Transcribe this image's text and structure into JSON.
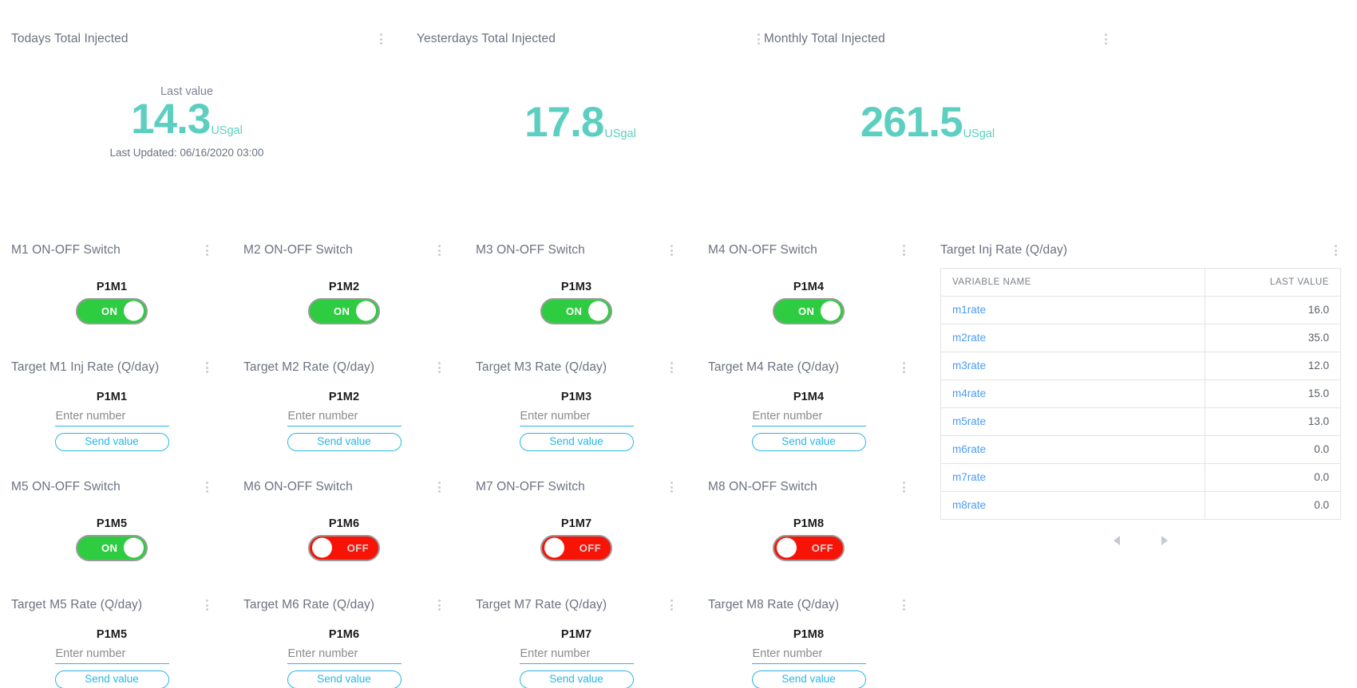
{
  "metrics": [
    {
      "title": "Todays Total Injected",
      "last_value_label": "Last value",
      "value": "14.3",
      "unit": "USgal",
      "updated": "Last Updated: 06/16/2020 03:00"
    },
    {
      "title": "Yesterdays Total Injected",
      "value": "17.8",
      "unit": "USgal"
    },
    {
      "title": "Monthly Total Injected",
      "value": "261.5",
      "unit": "USgal"
    }
  ],
  "switches": [
    {
      "title": "M1 ON-OFF Switch",
      "device": "P1M1",
      "state": "ON",
      "state_label": "ON"
    },
    {
      "title": "M2 ON-OFF Switch",
      "device": "P1M2",
      "state": "ON",
      "state_label": "ON"
    },
    {
      "title": "M3 ON-OFF Switch",
      "device": "P1M3",
      "state": "ON",
      "state_label": "ON"
    },
    {
      "title": "M4 ON-OFF Switch",
      "device": "P1M4",
      "state": "ON",
      "state_label": "ON"
    },
    {
      "title": "M5 ON-OFF Switch",
      "device": "P1M5",
      "state": "ON",
      "state_label": "ON"
    },
    {
      "title": "M6 ON-OFF Switch",
      "device": "P1M6",
      "state": "OFF",
      "state_label": "OFF"
    },
    {
      "title": "M7 ON-OFF Switch",
      "device": "P1M7",
      "state": "OFF",
      "state_label": "OFF"
    },
    {
      "title": "M8 ON-OFF Switch",
      "device": "P1M8",
      "state": "OFF",
      "state_label": "OFF"
    }
  ],
  "rate_inputs": [
    {
      "title": "Target M1 Inj Rate (Q/day)",
      "device": "P1M1",
      "placeholder": "Enter number",
      "value": "",
      "button": "Send value"
    },
    {
      "title": "Target M2 Rate (Q/day)",
      "device": "P1M2",
      "placeholder": "Enter number",
      "value": "",
      "button": "Send value"
    },
    {
      "title": "Target M3 Rate (Q/day)",
      "device": "P1M3",
      "placeholder": "Enter number",
      "value": "",
      "button": "Send value"
    },
    {
      "title": "Target M4 Rate (Q/day)",
      "device": "P1M4",
      "placeholder": "Enter number",
      "value": "",
      "button": "Send value"
    },
    {
      "title": "Target M5 Rate (Q/day)",
      "device": "P1M5",
      "placeholder": "Enter number",
      "value": "",
      "button": "Send value"
    },
    {
      "title": "Target M6 Rate (Q/day)",
      "device": "P1M6",
      "placeholder": "Enter number",
      "value": "",
      "button": "Send value"
    },
    {
      "title": "Target M7 Rate (Q/day)",
      "device": "P1M7",
      "placeholder": "Enter number",
      "value": "",
      "button": "Send value"
    },
    {
      "title": "Target M8 Rate (Q/day)",
      "device": "P1M8",
      "placeholder": "Enter number",
      "value": "",
      "button": "Send value"
    }
  ],
  "table": {
    "title": "Target Inj Rate (Q/day)",
    "columns": [
      "VARIABLE NAME",
      "LAST VALUE"
    ],
    "rows": [
      {
        "name": "m1rate",
        "value": "16.0"
      },
      {
        "name": "m2rate",
        "value": "35.0"
      },
      {
        "name": "m3rate",
        "value": "12.0"
      },
      {
        "name": "m4rate",
        "value": "15.0"
      },
      {
        "name": "m5rate",
        "value": "13.0"
      },
      {
        "name": "m6rate",
        "value": "0.0"
      },
      {
        "name": "m7rate",
        "value": "0.0"
      },
      {
        "name": "m8rate",
        "value": "0.0"
      }
    ],
    "pager": {
      "prev": "◀",
      "next": "▶"
    }
  },
  "colors": {
    "metric_accent": "#5ccfc0",
    "on_green": "#2ecc40",
    "off_red": "#f71306",
    "link_blue": "#4d9bf5",
    "action_blue": "#29b6e8"
  }
}
